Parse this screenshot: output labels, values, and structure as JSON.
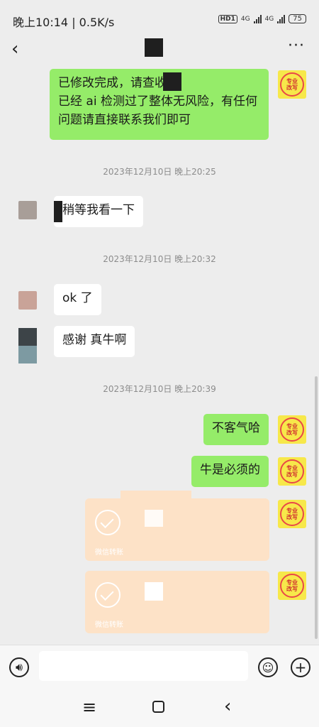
{
  "status": {
    "time": "晚上10:14 | 0.5K/s",
    "hd": "HD1",
    "net1": "4G",
    "net2": "4G",
    "battery": "75"
  },
  "nav": {
    "more": "···"
  },
  "messages": {
    "m1_line1": "已修改完成，请查收.",
    "m1_line2": "已经 ai 检测过了整体无风险，有任何问题请直接联系我们即可",
    "ts1": "2023年12月10日 晚上20:25",
    "m2": "稍等我看一下",
    "ts2": "2023年12月10日 晚上20:32",
    "m3": "ok 了",
    "m4": "感谢 真牛啊",
    "ts3": "2023年12月10日 晚上20:39",
    "m5": "不客气哈",
    "m6": "牛是必须的",
    "transfer1_label": "微信转账",
    "transfer2_label": "微信转账"
  },
  "me_avatar": {
    "line1": "专业",
    "line2": "改写"
  },
  "colors": {
    "my_bubble": "#95ec69",
    "their_bubble": "#ffffff",
    "transfer": "#fde2c7",
    "background": "#ededed"
  }
}
